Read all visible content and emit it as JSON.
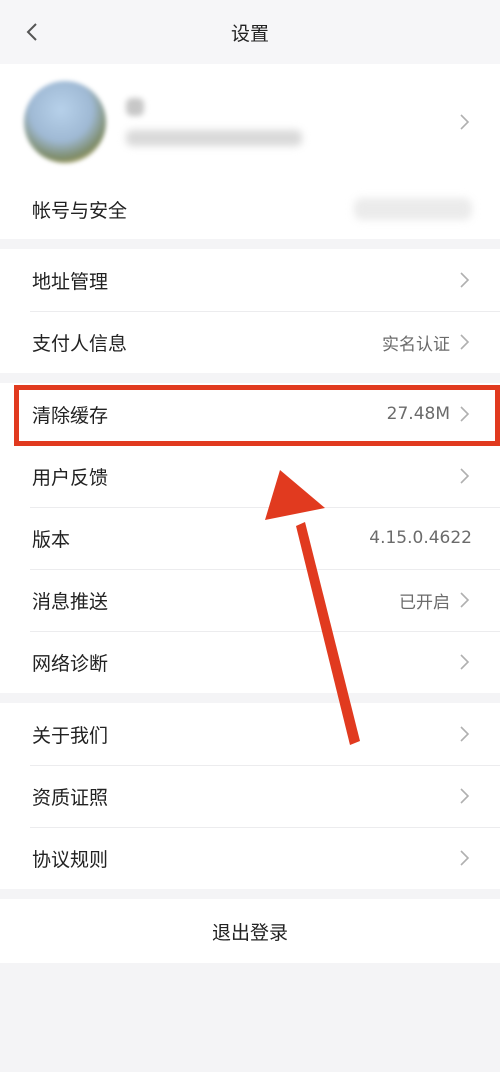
{
  "header": {
    "title": "设置"
  },
  "account": {
    "label": "帐号与安全"
  },
  "group1": [
    {
      "label": "地址管理",
      "value": ""
    },
    {
      "label": "支付人信息",
      "value": "实名认证"
    }
  ],
  "group2": [
    {
      "label": "清除缓存",
      "value": "27.48M"
    },
    {
      "label": "用户反馈",
      "value": ""
    },
    {
      "label": "版本",
      "value": "4.15.0.4622"
    },
    {
      "label": "消息推送",
      "value": "已开启"
    },
    {
      "label": "网络诊断",
      "value": ""
    }
  ],
  "group3": [
    {
      "label": "关于我们"
    },
    {
      "label": "资质证照"
    },
    {
      "label": "协议规则"
    }
  ],
  "logout": {
    "label": "退出登录"
  },
  "colors": {
    "annotation": "#e13a1f",
    "background": "#f4f4f6"
  },
  "icons": {
    "back": "chevron-left-icon",
    "row": "chevron-right-icon"
  }
}
